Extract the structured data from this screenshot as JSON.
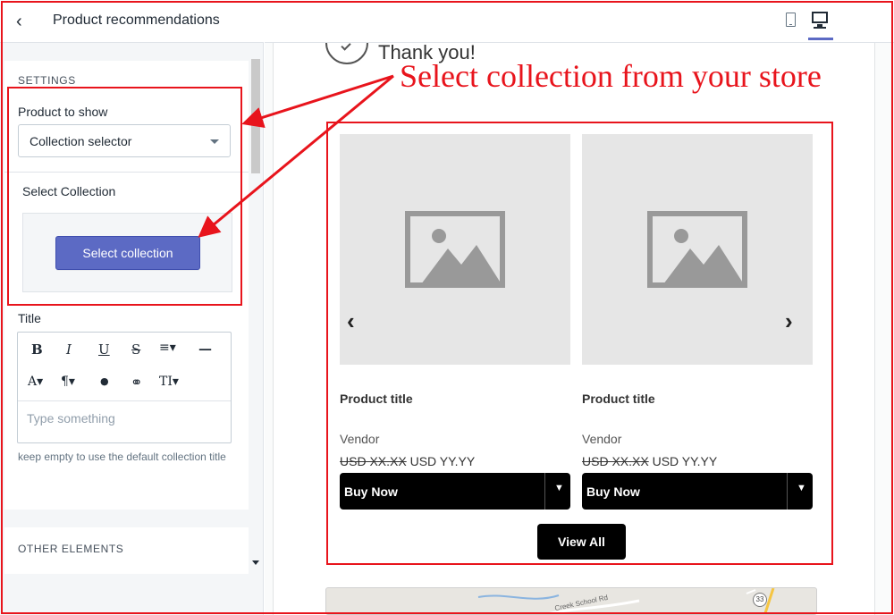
{
  "sidebar": {
    "title": "Product recommendations",
    "settings_heading": "SETTINGS",
    "product_to_show_label": "Product to show",
    "product_to_show_value": "Collection selector",
    "select_collection_label": "Select Collection",
    "select_collection_button": "Select collection",
    "title_label": "Title",
    "editor_placeholder": "Type something",
    "help_text": "keep empty to use the default collection title",
    "other_elements_heading": "OTHER ELEMENTS",
    "toolbar": {
      "bold": "B",
      "italic": "I",
      "underline": "U",
      "strike": "S",
      "align": "≡▾",
      "rule": "—",
      "font_color": "A▾",
      "paragraph": "¶▾",
      "ink": "●",
      "link": "⚭",
      "text_size": "TI▾"
    }
  },
  "preview": {
    "thank_you": "Thank you!",
    "products": [
      {
        "title": "Product title",
        "vendor": "Vendor",
        "old_price": "USD XX.XX",
        "new_price": "USD YY.YY",
        "button": "Buy Now"
      },
      {
        "title": "Product title",
        "vendor": "Vendor",
        "old_price": "USD XX.XX",
        "new_price": "USD YY.YY",
        "button": "Buy Now"
      }
    ],
    "view_all": "View All",
    "map_road": "Creek School Rd",
    "map_route": "33"
  },
  "annotation": {
    "text": "Select collection from your store",
    "color": "#e8141c"
  },
  "colors": {
    "primary_button": "#5c6ac4",
    "buy_button": "#000000"
  },
  "icons": {
    "back": "chevron-left-icon",
    "mobile": "mobile-icon",
    "desktop": "desktop-icon",
    "prev": "chevron-left-icon",
    "next": "chevron-right-icon"
  }
}
